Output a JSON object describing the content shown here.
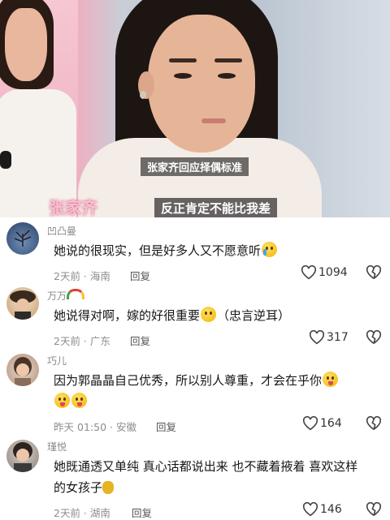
{
  "video": {
    "name_tag": "张家齐",
    "subtitle_small": "张家齐回应择偶标准",
    "subtitle_main": "反正肯定不能比我差"
  },
  "comments": [
    {
      "username": "凹凸曼",
      "text": "她说的很现实，但是好多人又不愿意听",
      "emoji_after": "cry-laugh-emoji",
      "time": "2天前",
      "location": "海南",
      "reply_label": "回复",
      "likes": "1094"
    },
    {
      "username": "万万",
      "username_emoji": "rainbow-emoji",
      "text": "她说得对啊，嫁的好很重要",
      "emoji_after": "smirk-emoji",
      "text_suffix": "（忠言逆耳）",
      "time": "2天前",
      "location": "广东",
      "reply_label": "回复",
      "likes": "317"
    },
    {
      "username": "巧儿",
      "text": "因为郭晶晶自己优秀，所以别人尊重，才会在乎你",
      "emoji_after": "wink-tongue-emoji",
      "time": "昨天",
      "clock": "01:50",
      "location": "安徽",
      "reply_label": "回复",
      "likes": "164"
    },
    {
      "username": "瑾悦",
      "text_line1": "她既通透又单纯 真心话都说出来 也不藏着掖着 喜欢这样",
      "text_line2": "的女孩子",
      "emoji_after": "money-bag-emoji",
      "time": "2天前",
      "location": "湖南",
      "reply_label": "回复",
      "likes": "146"
    }
  ]
}
